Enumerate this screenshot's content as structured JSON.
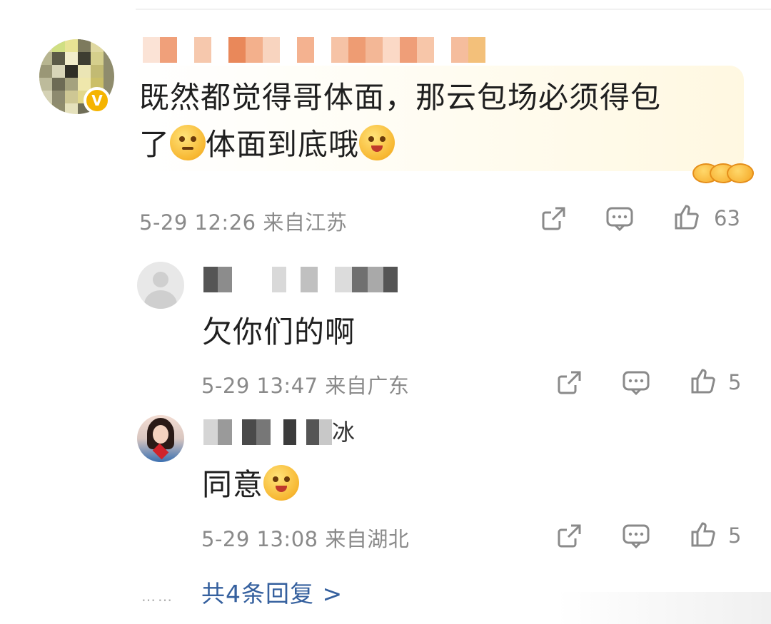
{
  "colors": {
    "link": "#35609e",
    "meta": "#8a8a8a",
    "badge": "#f5b400"
  },
  "main_comment": {
    "verified_badge_icon": "verified-v-icon",
    "text_line1": "既然都觉得哥体面，那云包场必须得包",
    "text_line2_a": "了",
    "text_line2_b": "体面到底哦",
    "emoji_1": "smirk-emoji-icon",
    "emoji_2": "hug-emoji-icon",
    "time": "5-29 12:26",
    "location": "来自江苏",
    "likes": "63"
  },
  "replies": [
    {
      "username_suffix": "",
      "text": "欠你们的啊",
      "time": "5-29 13:47",
      "location": "来自广东",
      "likes": "5"
    },
    {
      "username_suffix": "冰",
      "text": "同意",
      "time": "5-29 13:08",
      "location": "来自湖北",
      "likes": "5",
      "emoji": "hug-emoji-icon"
    }
  ],
  "more_replies": {
    "dots": "……",
    "label": "共4条回复 >"
  }
}
